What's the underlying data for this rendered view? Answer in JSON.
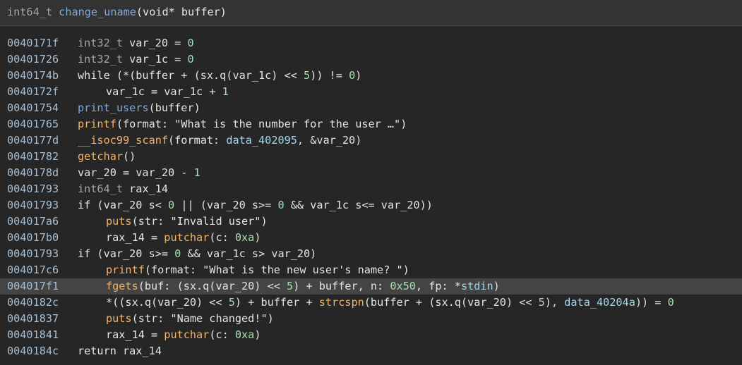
{
  "header": {
    "ret_type": "int64_t",
    "func_name": "change_uname",
    "params": "(void* buffer)"
  },
  "colors": {
    "background": "#262626",
    "address": "#a6bfd4",
    "function": "#82a8dc",
    "import": "#f2b36b",
    "number": "#a6e0b0",
    "data_symbol": "#a2d9f0",
    "type": "#9da6ae",
    "highlight": "#444444"
  },
  "lines": [
    {
      "addr": "0040171f",
      "indent": 0,
      "hl": false,
      "tokens": [
        [
          "ty",
          "int32_t"
        ],
        [
          "p",
          " var_20 = "
        ],
        [
          "num",
          "0"
        ]
      ]
    },
    {
      "addr": "00401726",
      "indent": 0,
      "hl": false,
      "tokens": [
        [
          "ty",
          "int32_t"
        ],
        [
          "p",
          " var_1c = "
        ],
        [
          "num",
          "0"
        ]
      ]
    },
    {
      "addr": "0040174b",
      "indent": 0,
      "hl": false,
      "tokens": [
        [
          "p",
          "while (*(buffer + (sx.q(var_1c) << "
        ],
        [
          "num",
          "5"
        ],
        [
          "p",
          ")) != "
        ],
        [
          "num",
          "0"
        ],
        [
          "p",
          ")"
        ]
      ]
    },
    {
      "addr": "0040172f",
      "indent": 1,
      "hl": false,
      "tokens": [
        [
          "p",
          "var_1c = var_1c + "
        ],
        [
          "num",
          "1"
        ]
      ]
    },
    {
      "addr": "00401754",
      "indent": 0,
      "hl": false,
      "tokens": [
        [
          "fn",
          "print_users"
        ],
        [
          "p",
          "(buffer)"
        ]
      ]
    },
    {
      "addr": "00401765",
      "indent": 0,
      "hl": false,
      "tokens": [
        [
          "im",
          "printf"
        ],
        [
          "p",
          "(format: \"What is the number for the user …\")"
        ]
      ]
    },
    {
      "addr": "0040177d",
      "indent": 0,
      "hl": false,
      "tokens": [
        [
          "im",
          "__isoc99_scanf"
        ],
        [
          "p",
          "(format: "
        ],
        [
          "dat",
          "data_402095"
        ],
        [
          "p",
          ", &var_20)"
        ]
      ]
    },
    {
      "addr": "00401782",
      "indent": 0,
      "hl": false,
      "tokens": [
        [
          "im",
          "getchar"
        ],
        [
          "p",
          "()"
        ]
      ]
    },
    {
      "addr": "0040178d",
      "indent": 0,
      "hl": false,
      "tokens": [
        [
          "p",
          "var_20 = var_20 - "
        ],
        [
          "num",
          "1"
        ]
      ]
    },
    {
      "addr": "00401793",
      "indent": 0,
      "hl": false,
      "tokens": [
        [
          "ty",
          "int64_t"
        ],
        [
          "p",
          " rax_14"
        ]
      ]
    },
    {
      "addr": "00401793",
      "indent": 0,
      "hl": false,
      "tokens": [
        [
          "p",
          "if (var_20 s< "
        ],
        [
          "num",
          "0"
        ],
        [
          "p",
          " || (var_20 s>= "
        ],
        [
          "num",
          "0"
        ],
        [
          "p",
          " && var_1c s<= var_20))"
        ]
      ]
    },
    {
      "addr": "004017a6",
      "indent": 1,
      "hl": false,
      "tokens": [
        [
          "im",
          "puts"
        ],
        [
          "p",
          "(str: \"Invalid user\")"
        ]
      ]
    },
    {
      "addr": "004017b0",
      "indent": 1,
      "hl": false,
      "tokens": [
        [
          "p",
          "rax_14 = "
        ],
        [
          "im",
          "putchar"
        ],
        [
          "p",
          "(c: "
        ],
        [
          "num",
          "0xa"
        ],
        [
          "p",
          ")"
        ]
      ]
    },
    {
      "addr": "00401793",
      "indent": 0,
      "hl": false,
      "tokens": [
        [
          "p",
          "if (var_20 s>= "
        ],
        [
          "num",
          "0"
        ],
        [
          "p",
          " && var_1c s> var_20)"
        ]
      ]
    },
    {
      "addr": "004017c6",
      "indent": 1,
      "hl": false,
      "tokens": [
        [
          "im",
          "printf"
        ],
        [
          "p",
          "(format: \"What is the new user's name? \")"
        ]
      ]
    },
    {
      "addr": "004017f1",
      "indent": 1,
      "hl": true,
      "tokens": [
        [
          "im",
          "fgets"
        ],
        [
          "p",
          "(buf: (sx.q(var_20) << "
        ],
        [
          "num",
          "5"
        ],
        [
          "p",
          ") + buffer, n: "
        ],
        [
          "num",
          "0x50"
        ],
        [
          "p",
          ", fp: *"
        ],
        [
          "dat",
          "stdin"
        ],
        [
          "p",
          ")"
        ]
      ]
    },
    {
      "addr": "0040182c",
      "indent": 1,
      "hl": false,
      "tokens": [
        [
          "p",
          "*((sx.q(var_20) << "
        ],
        [
          "num",
          "5"
        ],
        [
          "p",
          ") + buffer + "
        ],
        [
          "im",
          "strcspn"
        ],
        [
          "p",
          "(buffer + (sx.q(var_20) << "
        ],
        [
          "num",
          "5"
        ],
        [
          "p",
          "), "
        ],
        [
          "dat",
          "data_40204a"
        ],
        [
          "p",
          ")) = "
        ],
        [
          "num",
          "0"
        ]
      ]
    },
    {
      "addr": "00401837",
      "indent": 1,
      "hl": false,
      "tokens": [
        [
          "im",
          "puts"
        ],
        [
          "p",
          "(str: \"Name changed!\")"
        ]
      ]
    },
    {
      "addr": "00401841",
      "indent": 1,
      "hl": false,
      "tokens": [
        [
          "p",
          "rax_14 = "
        ],
        [
          "im",
          "putchar"
        ],
        [
          "p",
          "(c: "
        ],
        [
          "num",
          "0xa"
        ],
        [
          "p",
          ")"
        ]
      ]
    },
    {
      "addr": "0040184c",
      "indent": 0,
      "hl": false,
      "tokens": [
        [
          "p",
          "return rax_14"
        ]
      ]
    }
  ]
}
